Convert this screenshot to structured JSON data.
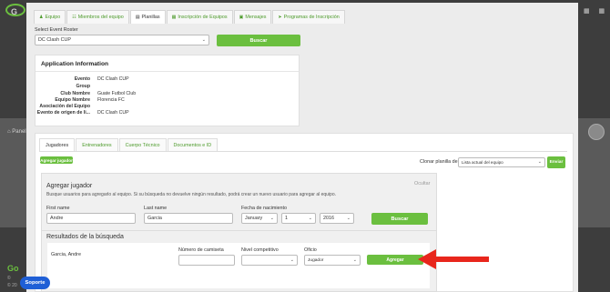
{
  "background": {
    "logo": "G",
    "panel_link": "Panel",
    "footer_logo": "Go",
    "footer_lines": [
      "© ",
      "© 20"
    ],
    "top_icons": "▦ ▦"
  },
  "tabs": [
    {
      "label": "Equipo",
      "icon": "group-icon"
    },
    {
      "label": "Miembros del equipo",
      "icon": "users-icon"
    },
    {
      "label": "Planillas",
      "icon": "list-icon"
    },
    {
      "label": "Inscripción de Equipos",
      "icon": "register-icon"
    },
    {
      "label": "Mensajes",
      "icon": "message-icon"
    },
    {
      "label": "Programas de Inscripción",
      "icon": "send-icon"
    }
  ],
  "roster": {
    "label": "Select Event Roster",
    "selected": "DC Clash CUP",
    "button": "Buscar"
  },
  "application_info": {
    "title": "Application Information",
    "rows": [
      {
        "key": "Evento",
        "value": "DC Clash CUP"
      },
      {
        "key": "Group",
        "value": ""
      },
      {
        "key": "Club Nombre",
        "value": "Guate Futbol Club"
      },
      {
        "key": "Equipo Nombre",
        "value": "Florencia FC"
      },
      {
        "key": "Asociación del Equipo",
        "value": ""
      },
      {
        "key": "Evento de origen de li...",
        "value": "DC Clash CUP"
      }
    ]
  },
  "inner_tabs": [
    "Jugadores",
    "Entrenadores",
    "Cuerpo Técnico",
    "Documentos e ID"
  ],
  "add_player_button": "Agregar jugador",
  "clone": {
    "label": "Clonar planilla de",
    "selected": "Lista actual del equipo",
    "button": "Enviar"
  },
  "add_box": {
    "title": "Agregar jugador",
    "hide": "Ocultar",
    "hint": "Busque usuarios para agregarlo al equipo. Si su búsqueda no devuelve ningún resultado, podrá crear un nuevo usuario para agregar al equipo.",
    "first_name_label": "First name",
    "first_name_value": "Andre",
    "last_name_label": "Last name",
    "last_name_value": "Garcia",
    "dob_label": "Fecha de nacimiento",
    "dob_month": "January",
    "dob_day": "1",
    "dob_year": "2016",
    "search_button": "Buscar",
    "results_title": "Resultados de la búsqueda"
  },
  "result": {
    "name": "Garcia, Andre",
    "jersey_label": "Número de camiseta",
    "jersey_value": "",
    "level_label": "Nivel competitivo",
    "level_value": "",
    "role_label": "Oficio",
    "role_value": "Jugador",
    "add_button": "Agregar"
  },
  "support_button": "Soporte",
  "colors": {
    "accent": "#6bbf3f",
    "arrow": "#e8261c",
    "support": "#1f5fd6"
  }
}
